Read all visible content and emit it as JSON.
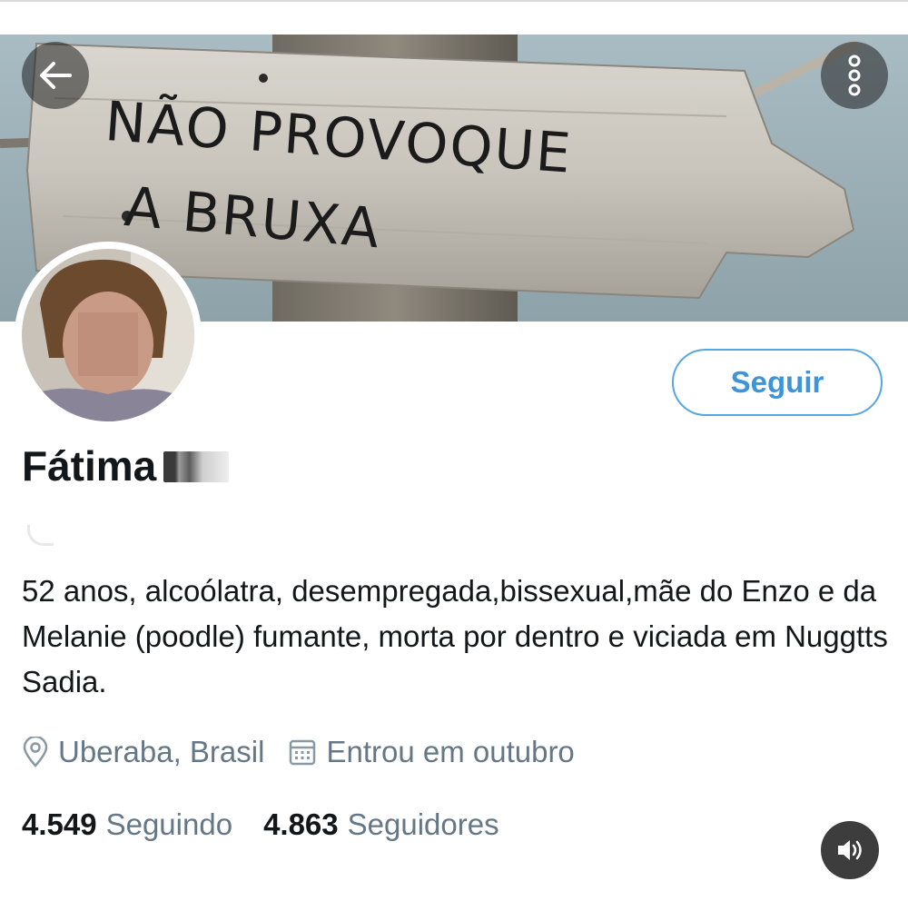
{
  "header": {
    "banner_text_line1": "NÃO PROVOQUE",
    "banner_text_line2": "A BRUXA",
    "back_icon": "arrow-left-icon",
    "more_icon": "more-vertical-icon"
  },
  "profile": {
    "name": "Fátima",
    "follow_label": "Seguir",
    "bio": "52 anos, alcoólatra, desempregada,bissexual,mãe do Enzo e da Melanie (poodle) fumante, morta por dentro e viciada em Nuggtts Sadia.",
    "location": "Uberaba, Brasil",
    "joined": "Entrou em outubro",
    "following_count": "4.549",
    "following_label": "Seguindo",
    "followers_count": "4.863",
    "followers_label": "Seguidores"
  },
  "colors": {
    "accent": "#3e94d8",
    "muted_text": "#657786",
    "primary_text": "#14171a"
  }
}
